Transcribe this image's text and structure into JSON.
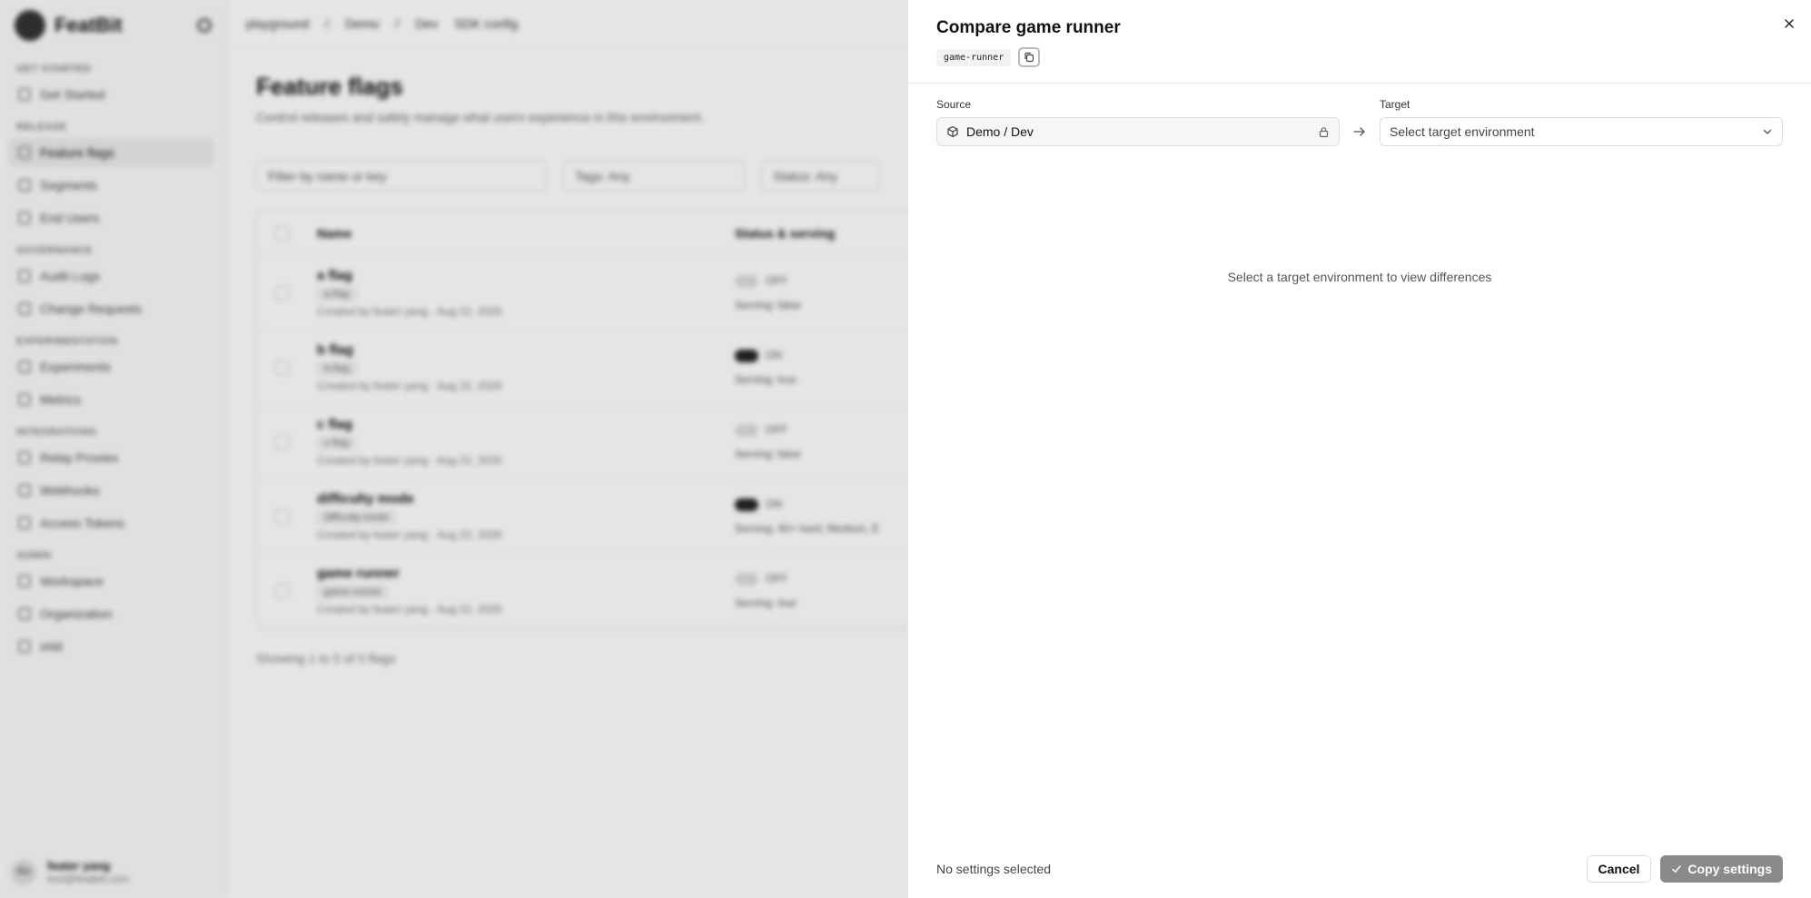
{
  "background": {
    "brand": "FeatBit",
    "sidebar": {
      "sections": [
        {
          "title": "Get Started",
          "items": [
            {
              "label": "Get Started",
              "active": false
            }
          ]
        },
        {
          "title": "Release",
          "items": [
            {
              "label": "Feature flags",
              "active": true
            },
            {
              "label": "Segments",
              "active": false
            },
            {
              "label": "End Users",
              "active": false
            }
          ]
        },
        {
          "title": "Governance",
          "items": [
            {
              "label": "Audit Logs",
              "active": false
            },
            {
              "label": "Change Requests",
              "active": false
            }
          ]
        },
        {
          "title": "Experimentation",
          "items": [
            {
              "label": "Experiments",
              "active": false
            },
            {
              "label": "Metrics",
              "active": false
            }
          ]
        },
        {
          "title": "Integrations",
          "items": [
            {
              "label": "Relay Proxies",
              "active": false
            },
            {
              "label": "Webhooks",
              "active": false
            },
            {
              "label": "Access Tokens",
              "active": false
            }
          ]
        },
        {
          "title": "Admin",
          "items": [
            {
              "label": "Workspace",
              "active": false
            },
            {
              "label": "Organization",
              "active": false
            },
            {
              "label": "IAM",
              "active": false
            }
          ]
        }
      ],
      "user": {
        "initials": "FU",
        "name": "feater yang",
        "email": "test@featbit.com"
      }
    },
    "topbar": {
      "crumbs": [
        "playground",
        "/",
        "Demo",
        "/",
        "Dev",
        "SDK config"
      ]
    },
    "page": {
      "title": "Feature flags",
      "subtitle": "Control releases and safely manage what users experience in this environment.",
      "filters": [
        "Filter by name or key",
        "Tags: Any",
        "Status: Any"
      ],
      "columns": {
        "name": "Name",
        "status": "Status & serving"
      },
      "rows": [
        {
          "name": "a flag",
          "key": "a-flag",
          "meta": "Created by feater yang · Aug 22, 2026",
          "status": "OFF",
          "on": false,
          "serving": "Serving: false"
        },
        {
          "name": "b flag",
          "key": "b-flag",
          "meta": "Created by feater yang · Aug 22, 2026",
          "status": "ON",
          "on": true,
          "serving": "Serving: true"
        },
        {
          "name": "c flag",
          "key": "c-flag",
          "meta": "Created by feater yang · Aug 22, 2026",
          "status": "OFF",
          "on": false,
          "serving": "Serving: false"
        },
        {
          "name": "difficulty mode",
          "key": "difficulty-mode",
          "meta": "Created by feater yang · Aug 22, 2026",
          "status": "ON",
          "on": true,
          "serving": "Serving: 40+ hard, Medium, E"
        },
        {
          "name": "game runner",
          "key": "game-runner",
          "meta": "Created by feater yang · Aug 22, 2026",
          "status": "OFF",
          "on": false,
          "serving": "Serving: true"
        }
      ],
      "showing": "Showing 1 to 5 of 5 flags"
    }
  },
  "drawer": {
    "title": "Compare game runner",
    "flag_key": "game-runner",
    "source_label": "Source",
    "source_value": "Demo / Dev",
    "target_label": "Target",
    "target_placeholder": "Select target environment",
    "empty_message": "Select a target environment to view differences",
    "footer_status": "No settings selected",
    "cancel_label": "Cancel",
    "copy_label": "Copy settings"
  }
}
